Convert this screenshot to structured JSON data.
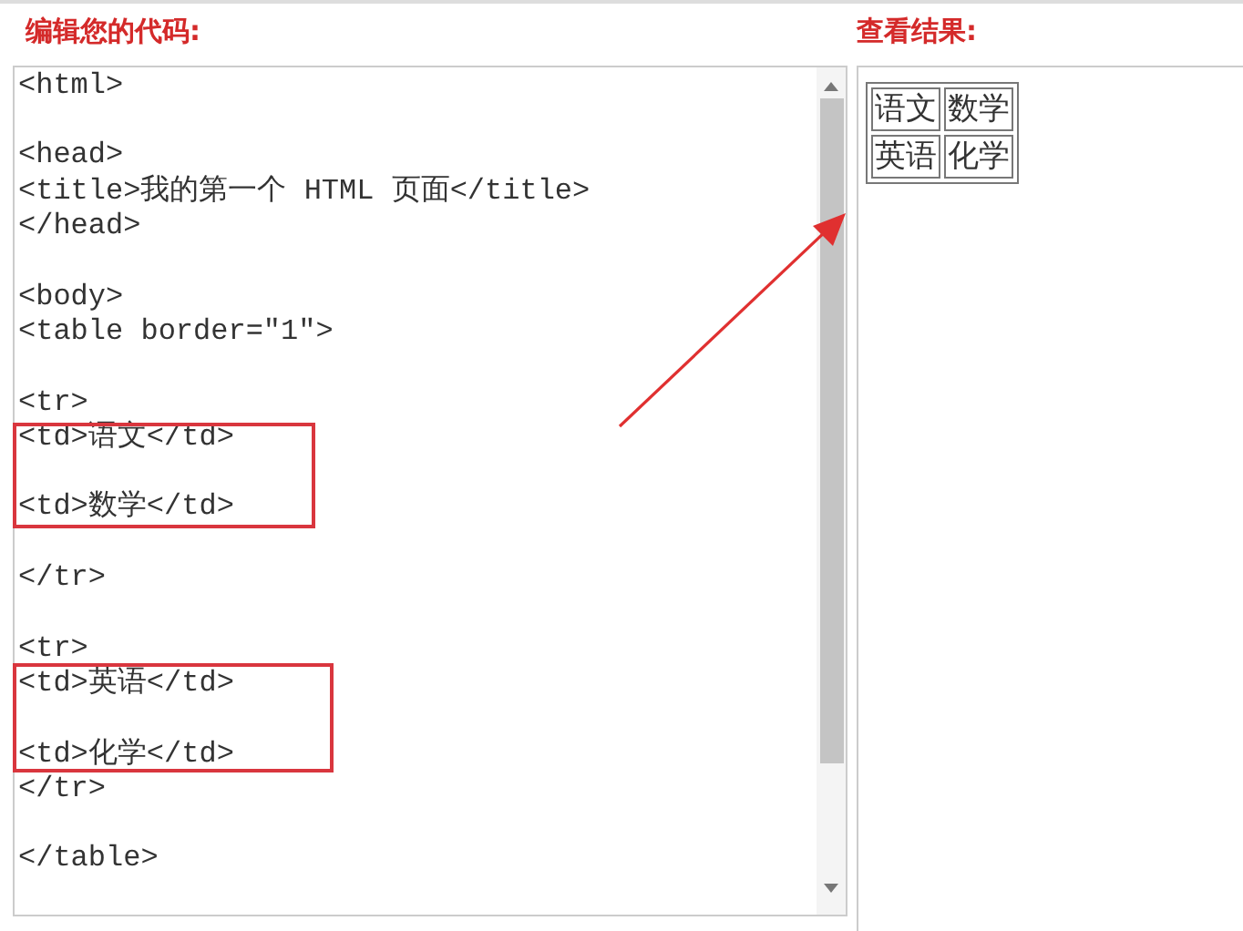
{
  "editor": {
    "heading": "编辑您的代码:",
    "code_blocks": [
      [
        "<html>"
      ],
      [
        "<head>",
        "<title>我的第一个 HTML 页面</title>",
        "</head>"
      ],
      [
        "<body>",
        "<table border=\"1\">"
      ],
      [
        "<tr>",
        "<td>语文</td>"
      ],
      [
        "<td>数学</td>"
      ],
      [
        "</tr>"
      ],
      [
        "<tr>",
        "<td>英语</td>"
      ],
      [
        "<td>化学</td>",
        "</tr>"
      ],
      [
        "</table>"
      ]
    ]
  },
  "result": {
    "heading": "查看结果:",
    "table_rows": [
      [
        "语文",
        "数学"
      ],
      [
        "英语",
        "化学"
      ]
    ]
  }
}
